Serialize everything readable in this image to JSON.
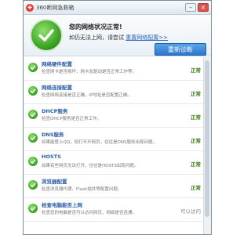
{
  "window": {
    "title": "360断网急救箱",
    "logo_glyph": "✚",
    "controls": {
      "minimize": "–",
      "close": "×"
    }
  },
  "header": {
    "status_title": "您的网络状况正常!",
    "status_hint": "如仍无法上网，请尝试",
    "reset_link": "重置网络配置>>",
    "rediag_button": "重新诊断",
    "status_icon": "checkmark-icon",
    "badge_color": "#2f9a1c"
  },
  "items": [
    {
      "title": "网络硬件配置",
      "desc": "检查网卡是否损坏，网卡及驱动是否正常工作等。",
      "status": "正常"
    },
    {
      "title": "网络连接配置",
      "desc": "检查网络连接是否正确，IP地址是否配置正确。",
      "status": "正常"
    },
    {
      "title": "DHCP服务",
      "desc": "检查DHCP服务是否正常工作。",
      "status": "正常"
    },
    {
      "title": "DNS服务",
      "desc": "如果能登上QQ，但打不开网页，往往是DNS服务出现问题。",
      "status": "正常"
    },
    {
      "title": "HOSTS",
      "desc": "如果有些网页无法打开，往往是HOSTS出现问题。",
      "status": "正常"
    },
    {
      "title": "浏览器配置",
      "desc": "检查浏览器代理、Flash插件等配置问题。",
      "status": "正常"
    },
    {
      "title": "检查电脑能否上网",
      "desc": "检查您的电脑是否可以访问网页，网络是否连通。",
      "status": "可以访问"
    }
  ],
  "colors": {
    "accent": "#2a5fa8",
    "ok": "#3a7d16",
    "button": "#2c77cf"
  }
}
